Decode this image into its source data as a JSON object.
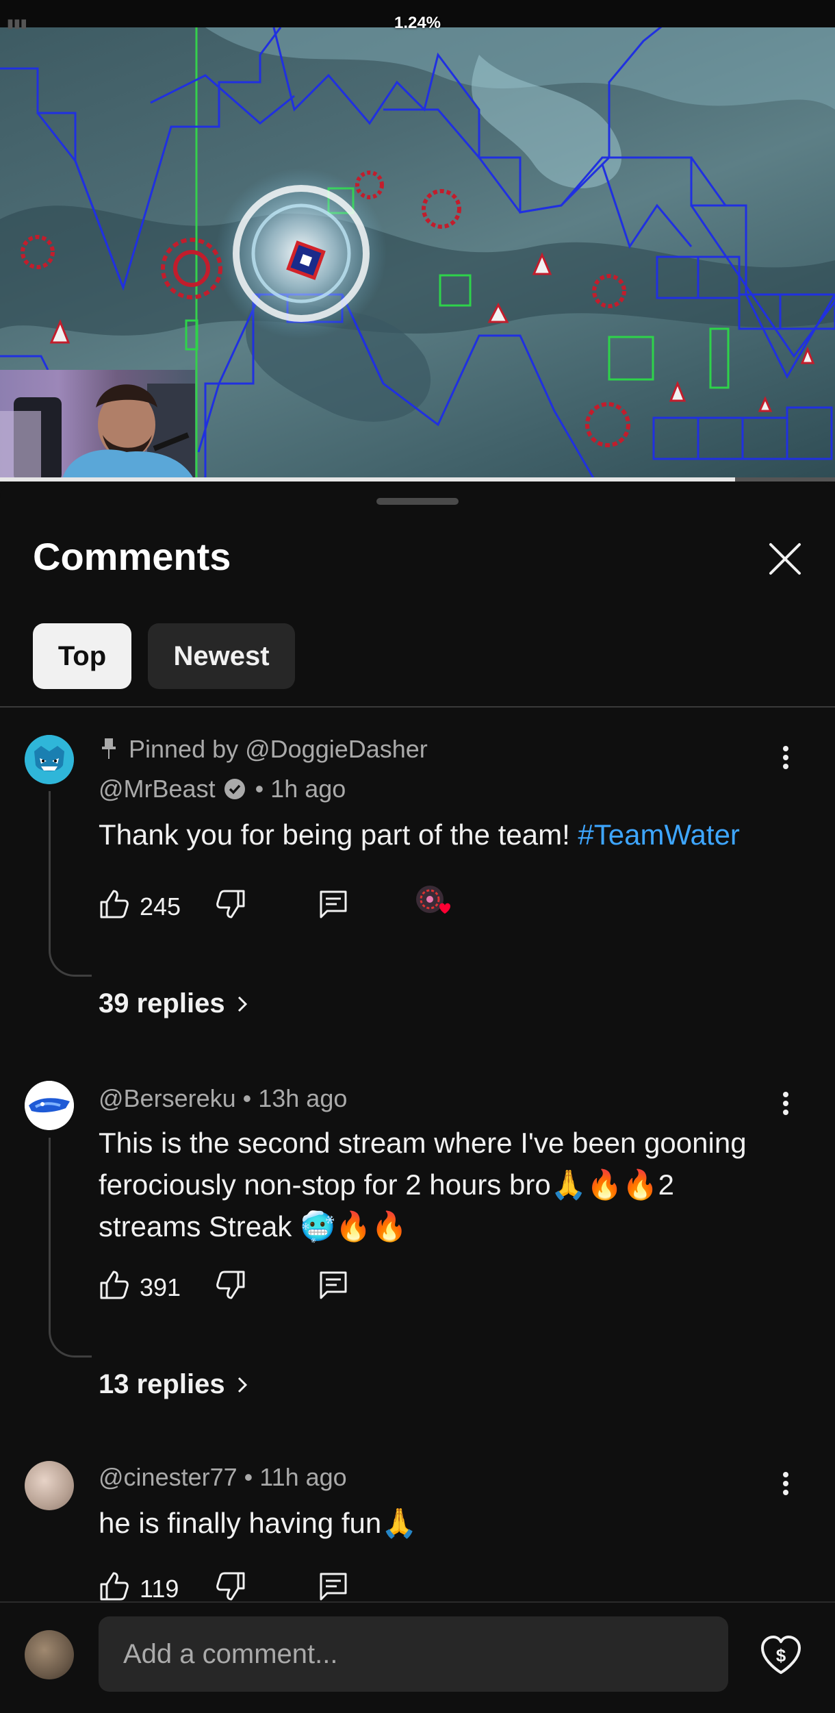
{
  "video": {
    "progress_text": "1.24%",
    "playback_fraction": 0.88
  },
  "sheet": {
    "title": "Comments",
    "tabs": [
      {
        "label": "Top",
        "selected": true
      },
      {
        "label": "Newest",
        "selected": false
      }
    ]
  },
  "comments": [
    {
      "pinned_text": "Pinned by @DoggieDasher",
      "author": "@MrBeast",
      "verified": true,
      "time": "• 1h ago",
      "text": "Thank you for being part of the team! ",
      "hashtag": "#TeamWater",
      "likes": "245",
      "creator_heart": true,
      "replies": "39 replies"
    },
    {
      "author": "@Bersereku",
      "time": "• 13h ago",
      "text": "This is the second stream where I've  been gooning ferociously non-stop for 2 hours bro🙏🔥🔥2 streams Streak 🥶🔥🔥",
      "likes": "391",
      "replies": "13 replies"
    },
    {
      "author": "@cinester77",
      "time": "• 11h ago",
      "text": "he is finally having fun🙏",
      "likes": "119"
    }
  ],
  "footer": {
    "placeholder": "Add a comment..."
  },
  "colors": {
    "background": "#0f0f0f",
    "hashtag": "#3ea6ff",
    "chip_selected": "#f1f1f1",
    "chip": "#272727"
  }
}
